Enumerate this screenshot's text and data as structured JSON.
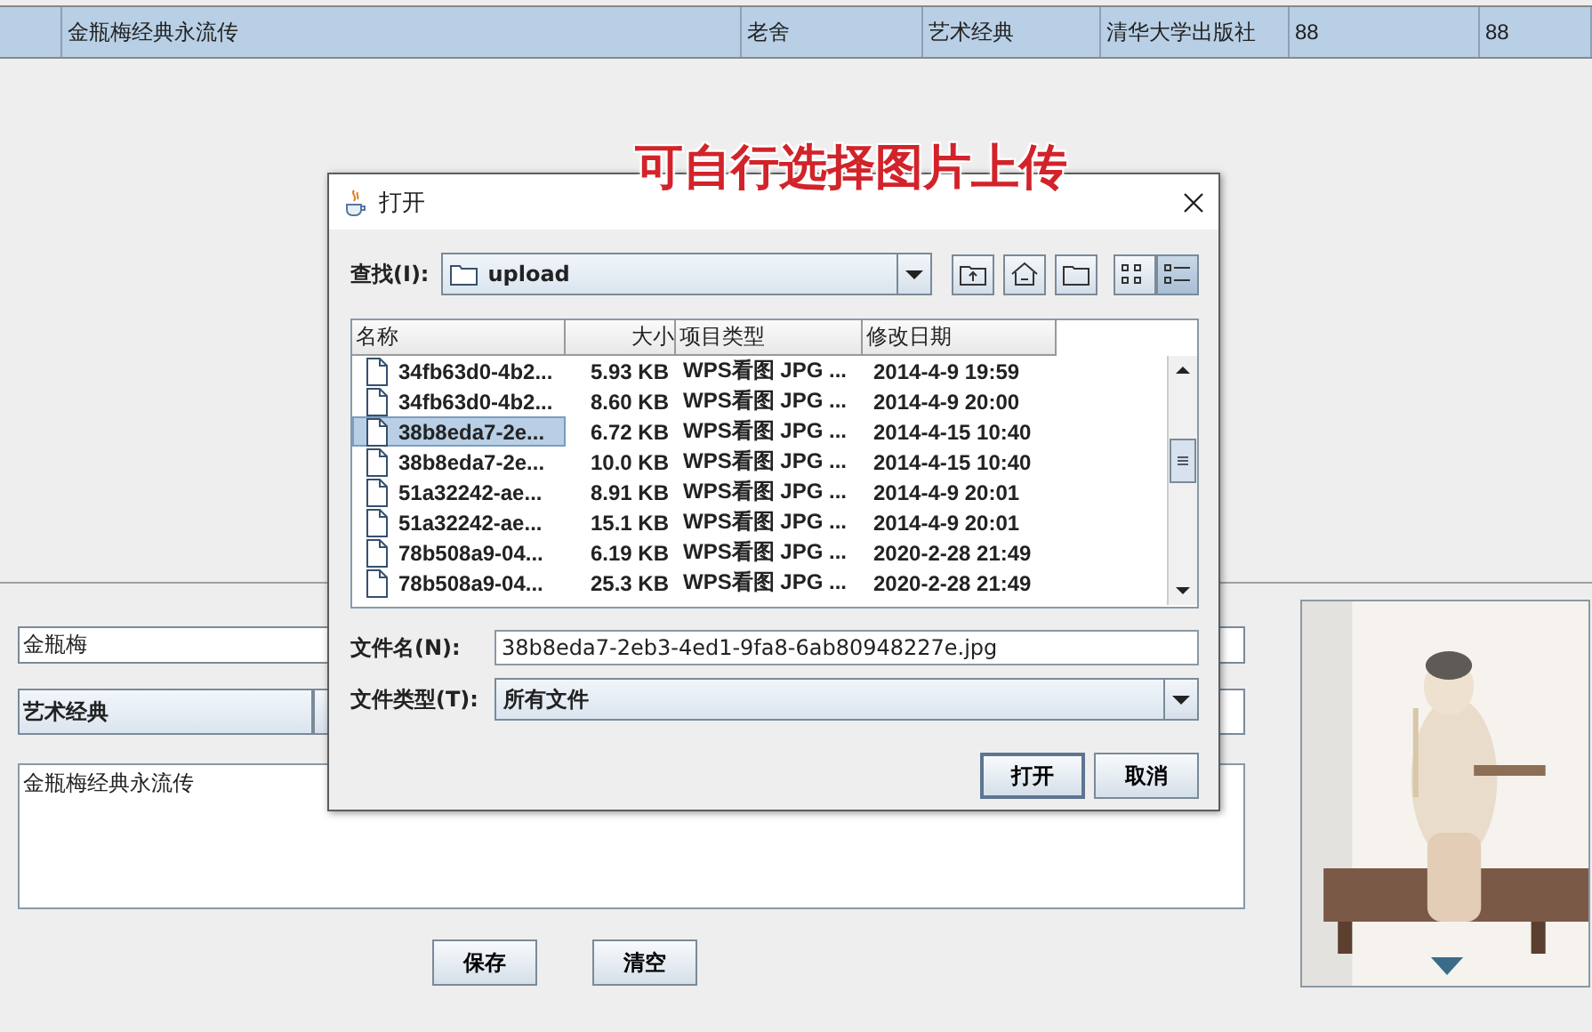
{
  "table": {
    "rows": [
      {
        "selected": true,
        "cells": [
          "金瓶梅经典永流传",
          "老舍",
          "艺术经典",
          "清华大学出版社",
          "88",
          "88"
        ]
      }
    ]
  },
  "annotation": "可自行选择图片上传",
  "form": {
    "name_field": {
      "value": "金瓶梅"
    },
    "category": {
      "value": "艺术经典"
    },
    "description": {
      "value": "金瓶梅经典永流传"
    },
    "buttons": [
      "保存",
      "清空"
    ]
  },
  "dialog": {
    "title": "打开",
    "look_in_label": "查找(I):",
    "look_in": "upload",
    "toolbar": [
      {
        "kind": "up",
        "selected": false
      },
      {
        "kind": "home",
        "selected": false
      },
      {
        "kind": "new-folder",
        "selected": false
      },
      {
        "kind": "list",
        "selected": false
      },
      {
        "kind": "details",
        "selected": true
      }
    ],
    "columns": [
      "名称",
      "大小",
      "项目类型",
      "修改日期"
    ],
    "files": [
      {
        "name": "34fb63d0-4b2...",
        "size": "5.93 KB",
        "type": "WPS看图 JPG ...",
        "modified": "2014-4-9 19:59",
        "selected": false
      },
      {
        "name": "34fb63d0-4b2...",
        "size": "8.60 KB",
        "type": "WPS看图 JPG ...",
        "modified": "2014-4-9 20:00",
        "selected": false
      },
      {
        "name": "38b8eda7-2e...",
        "size": "6.72 KB",
        "type": "WPS看图 JPG ...",
        "modified": "2014-4-15 10:40",
        "selected": true
      },
      {
        "name": "38b8eda7-2e...",
        "size": "10.0 KB",
        "type": "WPS看图 JPG ...",
        "modified": "2014-4-15 10:40",
        "selected": false
      },
      {
        "name": "51a32242-ae...",
        "size": "8.91 KB",
        "type": "WPS看图 JPG ...",
        "modified": "2014-4-9 20:01",
        "selected": false
      },
      {
        "name": "51a32242-ae...",
        "size": "15.1 KB",
        "type": "WPS看图 JPG ...",
        "modified": "2014-4-9 20:01",
        "selected": false
      },
      {
        "name": "78b508a9-04...",
        "size": "6.19 KB",
        "type": "WPS看图 JPG ...",
        "modified": "2020-2-28 21:49",
        "selected": false
      },
      {
        "name": "78b508a9-04...",
        "size": "25.3 KB",
        "type": "WPS看图 JPG ...",
        "modified": "2020-2-28 21:49",
        "selected": false
      }
    ],
    "file_name_label": "文件名(N):",
    "file_name": "38b8eda7-2eb3-4ed1-9fa8-6ab80948227e.jpg",
    "file_type_label": "文件类型(T):",
    "file_type": "所有文件",
    "buttons": [
      "打开",
      "取消"
    ]
  }
}
